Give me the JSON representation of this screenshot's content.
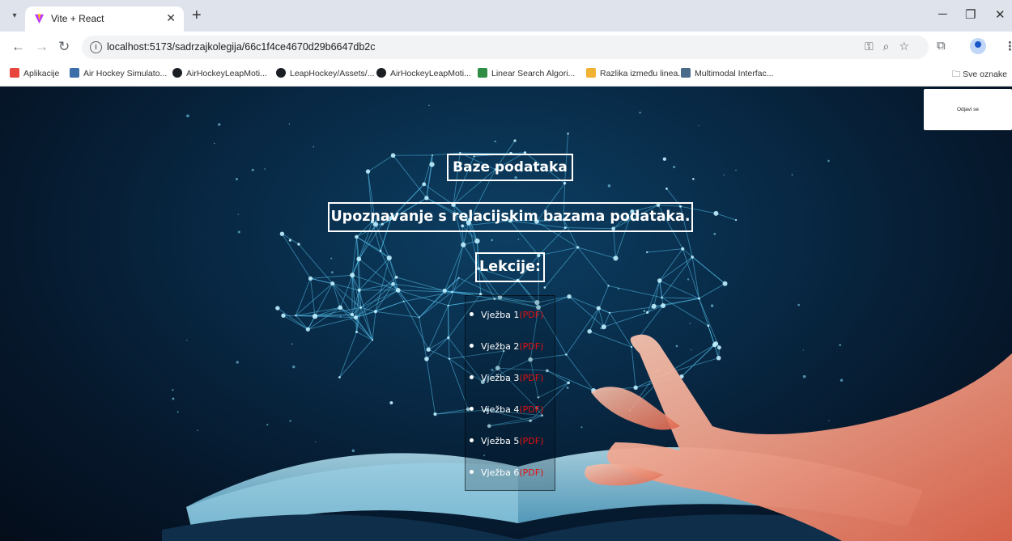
{
  "browser": {
    "tab_title": "Vite + React",
    "url": "localhost:5173/sadrzajkolegija/66c1f4ce4670d29b6647db2c",
    "bookmarks": [
      {
        "label": "Aplikacije",
        "icon": "apps-grid-icon",
        "color": "#e8453c"
      },
      {
        "label": "Air Hockey Simulato...",
        "icon": "site-favicon-icon",
        "color": "#3b6ea8"
      },
      {
        "label": "AirHockeyLeapMoti...",
        "icon": "github-icon",
        "color": "#1b1f23"
      },
      {
        "label": "LeapHockey/Assets/...",
        "icon": "github-icon",
        "color": "#1b1f23"
      },
      {
        "label": "AirHockeyLeapMoti...",
        "icon": "github-icon",
        "color": "#1b1f23"
      },
      {
        "label": "Linear Search Algori...",
        "icon": "gfg-icon",
        "color": "#2f8d46"
      },
      {
        "label": "Razlika između linea...",
        "icon": "pencil-icon",
        "color": "#f2b233"
      },
      {
        "label": "Multimodal Interfac...",
        "icon": "site-favicon-icon",
        "color": "#4a6a8a"
      }
    ],
    "all_bookmarks_label": "Sve oznake"
  },
  "page": {
    "logout_label": "Odjavi se",
    "course_title": "Baze podataka",
    "course_description": "Upoznavanje s relacijskim bazama podataka.",
    "lessons_heading": "Lekcije:",
    "lessons": [
      {
        "label": "Vježba 1",
        "link": "(PDF)"
      },
      {
        "label": "Vježba 2",
        "link": "(PDF)"
      },
      {
        "label": "Vježba 3",
        "link": "(PDF)"
      },
      {
        "label": "Vježba 4",
        "link": "(PDF)"
      },
      {
        "label": "Vježba 5",
        "link": "(PDF)"
      },
      {
        "label": "Vježba 6",
        "link": "(PDF)"
      }
    ]
  },
  "colors": {
    "pdf_link": "#e01010",
    "background": "#082b48",
    "network_lines": "#56c3ee"
  }
}
